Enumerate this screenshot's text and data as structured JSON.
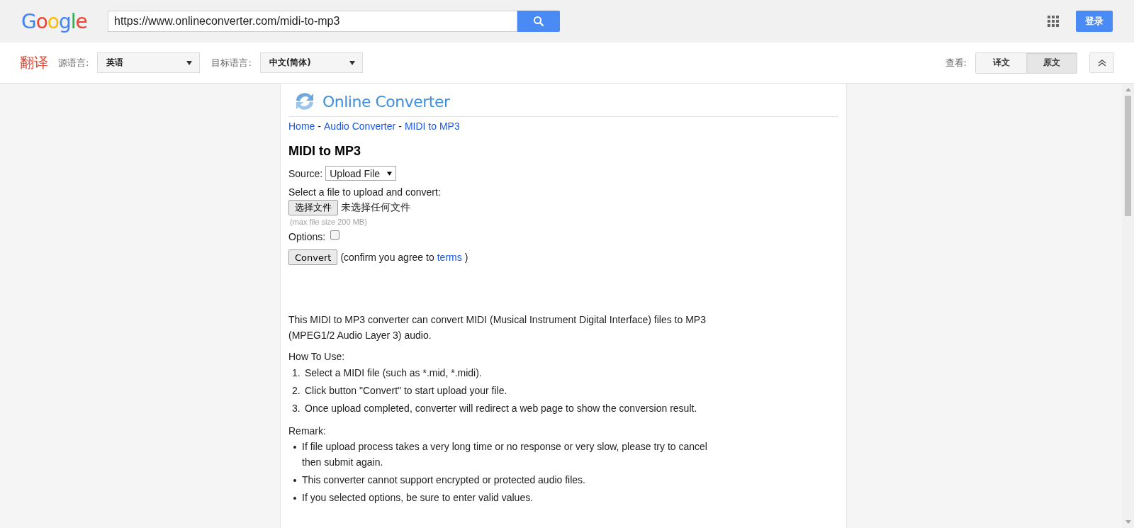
{
  "topbar": {
    "logo": "Google",
    "url": "https://www.onlineconverter.com/midi-to-mp3",
    "login": "登录"
  },
  "translate_bar": {
    "title": "翻译",
    "source_label": "源语言:",
    "source_value": "英语",
    "target_label": "目标语言:",
    "target_value": "中文(简体)",
    "view_label": "查看:",
    "view_tabs": [
      {
        "label": "译文",
        "selected": false
      },
      {
        "label": "原文",
        "selected": true
      }
    ]
  },
  "page": {
    "site_title": "Online Converter",
    "breadcrumb": [
      {
        "label": "Home"
      },
      {
        "label": "Audio Converter"
      },
      {
        "label": "MIDI to MP3"
      }
    ],
    "breadcrumb_separator": "-",
    "heading": "MIDI to MP3",
    "source_label": "Source:",
    "source_value": "Upload File",
    "select_prompt": "Select a file to upload and convert:",
    "choose_button": "选择文件",
    "no_file": "未选择任何文件",
    "max_size": "(max file size 200 MB)",
    "options_label": "Options:",
    "options_checked": false,
    "convert_button": "Convert",
    "confirm_before": "(confirm you agree to",
    "terms_link": "terms",
    "confirm_after": ")",
    "description": "This MIDI to MP3 converter can convert MIDI (Musical Instrument Digital Interface) files to MP3 (MPEG1/2 Audio Layer 3) audio.",
    "how_to_title": "How To Use:",
    "steps": [
      {
        "number": "1.",
        "text": "Select a MIDI file (such as *.mid, *.midi)."
      },
      {
        "number": "2.",
        "text": "Click button \"Convert\" to start upload your file."
      },
      {
        "number": "3.",
        "text": "Once upload completed, converter will redirect a web page to show the conversion result."
      }
    ],
    "remark_title": "Remark:",
    "remarks": [
      "If file upload process takes a very long time or no response or very slow, please try to cancel then submit again.",
      "This converter cannot support encrypted or protected audio files.",
      "If you selected options, be sure to enter valid values."
    ]
  }
}
